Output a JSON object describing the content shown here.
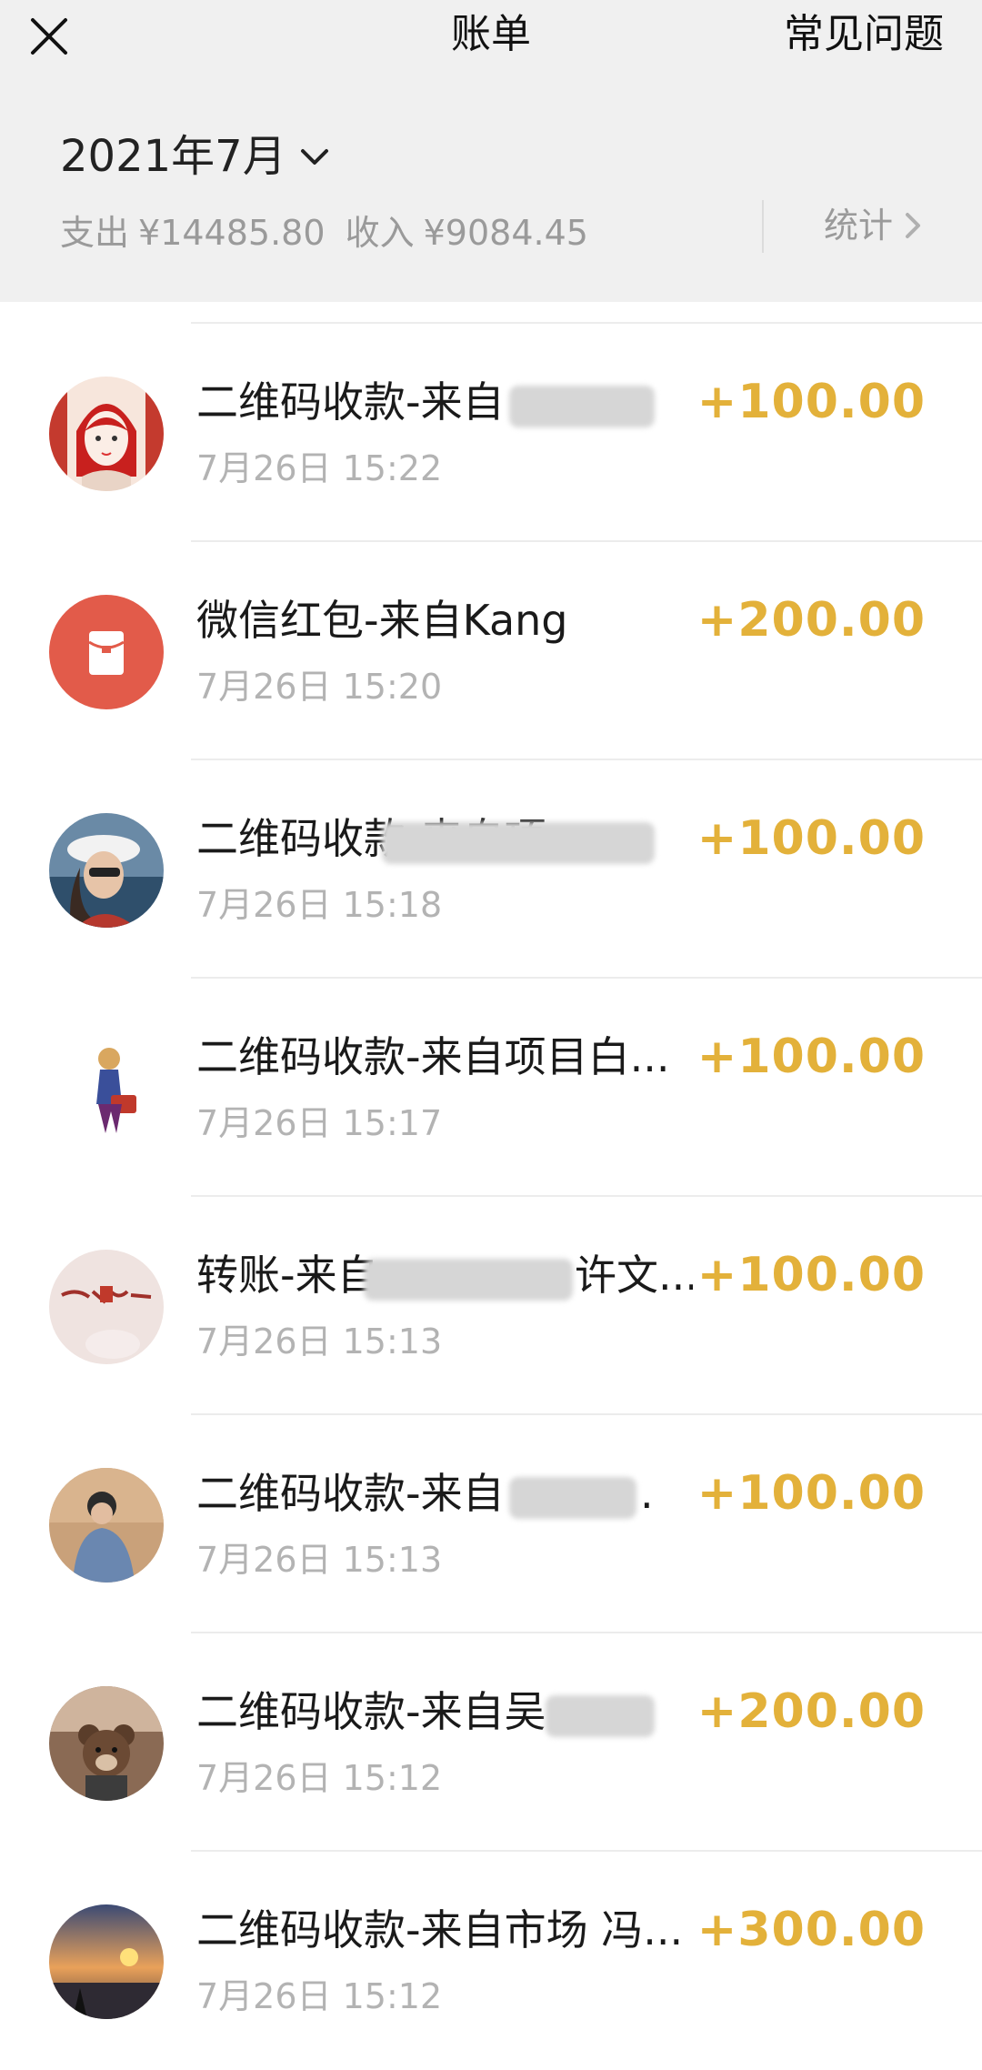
{
  "header": {
    "title": "账单",
    "faq_label": "常见问题",
    "close_icon": "close-icon"
  },
  "summary": {
    "month": "2021年7月",
    "expense_label": "支出",
    "expense_value": "¥14485.80",
    "income_label": "收入",
    "income_value": "¥9084.45",
    "stats_label": "统计"
  },
  "transactions": [
    {
      "title": "二维码收款-来自",
      "time": "7月26日 15:22",
      "amount": "+100.00",
      "avatar": "girl-illustration-avatar"
    },
    {
      "title": "微信红包-来自Kang",
      "time": "7月26日 15:20",
      "amount": "+200.00",
      "avatar": "red-packet-icon"
    },
    {
      "title": "二维码收款-来自项",
      "time": "7月26日 15:18",
      "amount": "+100.00",
      "avatar": "woman-hat-avatar"
    },
    {
      "title": "二维码收款-来自项目白...",
      "time": "7月26日 15:17",
      "amount": "+100.00",
      "avatar": "cartoon-figure-avatar"
    },
    {
      "title": "转账-来自",
      "title_tail": "许文...",
      "time": "7月26日 15:13",
      "amount": "+100.00",
      "avatar": "calligraphy-avatar"
    },
    {
      "title": "二维码收款-来自",
      "title_tail": ".",
      "time": "7月26日 15:13",
      "amount": "+100.00",
      "avatar": "person-outdoor-avatar"
    },
    {
      "title": "二维码收款-来自吴",
      "time": "7月26日 15:12",
      "amount": "+200.00",
      "avatar": "teddy-bear-avatar"
    },
    {
      "title": "二维码收款-来自市场 冯...",
      "time": "7月26日 15:12",
      "amount": "+300.00",
      "avatar": "sunset-avatar"
    }
  ],
  "colors": {
    "amount": "#e3b13a",
    "header_bg": "#f0f0f0",
    "red_packet": "#e25b4a"
  }
}
